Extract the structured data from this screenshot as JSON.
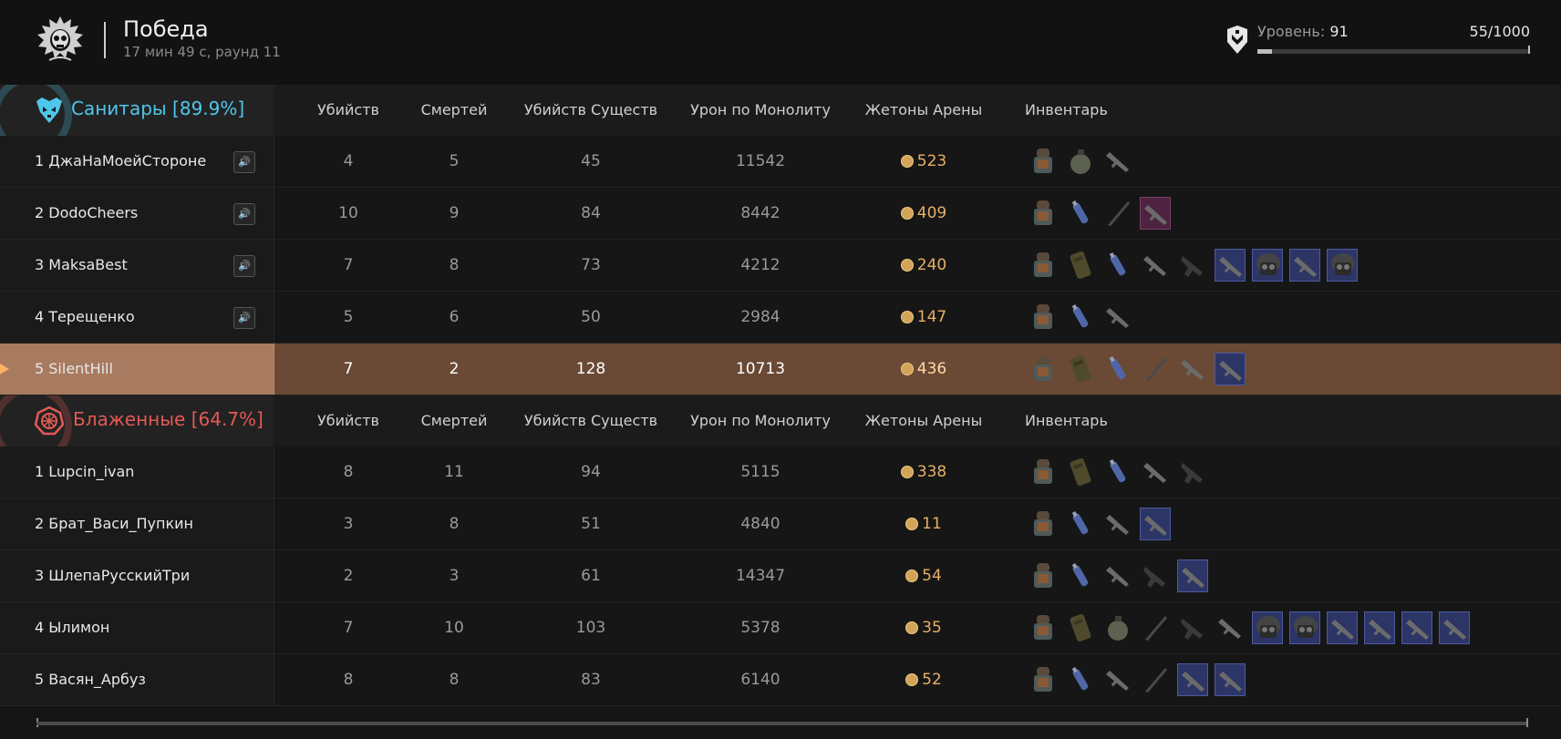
{
  "header": {
    "result": "Победа",
    "subtitle": "17 мин 49 с, раунд 11",
    "level_label": "Уровень:",
    "level_value": "91",
    "xp": "55/1000",
    "xp_fraction": 0.055
  },
  "columns": [
    "Убийств",
    "Смертей",
    "Убийств Существ",
    "Урон по Монолиту",
    "Жетоны Арены",
    "Инвентарь"
  ],
  "teams": [
    {
      "name": "Санитары [89.9%]",
      "color": "#4fc6ea",
      "players": [
        {
          "name": "1 ДжаНаМоейСтороне",
          "kills": "4",
          "deaths": "5",
          "creature_kills": "45",
          "monolith_damage": "11542",
          "tokens": "523",
          "has_voice": true,
          "inventory": [
            "armor-icon",
            "grenade-icon",
            "rifle-icon"
          ]
        },
        {
          "name": "2 DodoCheers",
          "kills": "10",
          "deaths": "9",
          "creature_kills": "84",
          "monolith_damage": "8442",
          "tokens": "409",
          "has_voice": true,
          "inventory": [
            "armor-icon",
            "medkit-icon",
            "knife-icon",
            "rifle-icon"
          ]
        },
        {
          "name": "3 MaksaBest",
          "kills": "7",
          "deaths": "8",
          "creature_kills": "73",
          "monolith_damage": "4212",
          "tokens": "240",
          "has_voice": true,
          "inventory": [
            "armor-icon",
            "backpack-icon",
            "medkit-icon",
            "rifle-icon",
            "pistol-icon",
            "rifle-icon",
            "helmet-icon",
            "rifle-icon",
            "helmet-icon"
          ]
        },
        {
          "name": "4 Терещенко",
          "kills": "5",
          "deaths": "6",
          "creature_kills": "50",
          "monolith_damage": "2984",
          "tokens": "147",
          "has_voice": true,
          "inventory": [
            "armor-icon",
            "medkit-icon",
            "rifle-icon"
          ]
        },
        {
          "name": "5 SilentHill",
          "kills": "7",
          "deaths": "2",
          "creature_kills": "128",
          "monolith_damage": "10713",
          "tokens": "436",
          "has_voice": false,
          "is_self": true,
          "inventory": [
            "armor-icon",
            "backpack-icon",
            "medkit-icon",
            "knife-icon",
            "rifle-icon",
            "rifle-icon"
          ]
        }
      ]
    },
    {
      "name": "Блаженные [64.7%]",
      "color": "#e25a55",
      "players": [
        {
          "name": "1 Lupcin_ivan",
          "kills": "8",
          "deaths": "11",
          "creature_kills": "94",
          "monolith_damage": "5115",
          "tokens": "338",
          "has_voice": false,
          "inventory": [
            "armor-icon",
            "backpack-icon",
            "medkit-icon",
            "rifle-icon",
            "pistol-icon"
          ]
        },
        {
          "name": "2 Брат_Васи_Пупкин",
          "kills": "3",
          "deaths": "8",
          "creature_kills": "51",
          "monolith_damage": "4840",
          "tokens": "11",
          "has_voice": false,
          "inventory": [
            "armor-icon",
            "medkit-icon",
            "rifle-icon",
            "rifle-icon"
          ]
        },
        {
          "name": "3 ШлепаРусскийТри",
          "kills": "2",
          "deaths": "3",
          "creature_kills": "61",
          "monolith_damage": "14347",
          "tokens": "54",
          "has_voice": false,
          "inventory": [
            "armor-icon",
            "medkit-icon",
            "rifle-icon",
            "pistol-icon",
            "rifle-icon"
          ]
        },
        {
          "name": "4 Ылимон",
          "kills": "7",
          "deaths": "10",
          "creature_kills": "103",
          "monolith_damage": "5378",
          "tokens": "35",
          "has_voice": false,
          "inventory": [
            "armor-icon",
            "backpack-icon",
            "grenade-icon",
            "knife-icon",
            "pistol-icon",
            "rifle-icon",
            "helmet-icon",
            "helmet-icon",
            "rifle-icon",
            "rifle-icon",
            "rifle-icon",
            "rifle-icon"
          ]
        },
        {
          "name": "5 Васян_Арбуз",
          "kills": "8",
          "deaths": "8",
          "creature_kills": "83",
          "monolith_damage": "6140",
          "tokens": "52",
          "has_voice": false,
          "inventory": [
            "armor-icon",
            "medkit-icon",
            "rifle-icon",
            "knife-icon",
            "rifle-icon",
            "rifle-icon"
          ]
        }
      ]
    }
  ]
}
